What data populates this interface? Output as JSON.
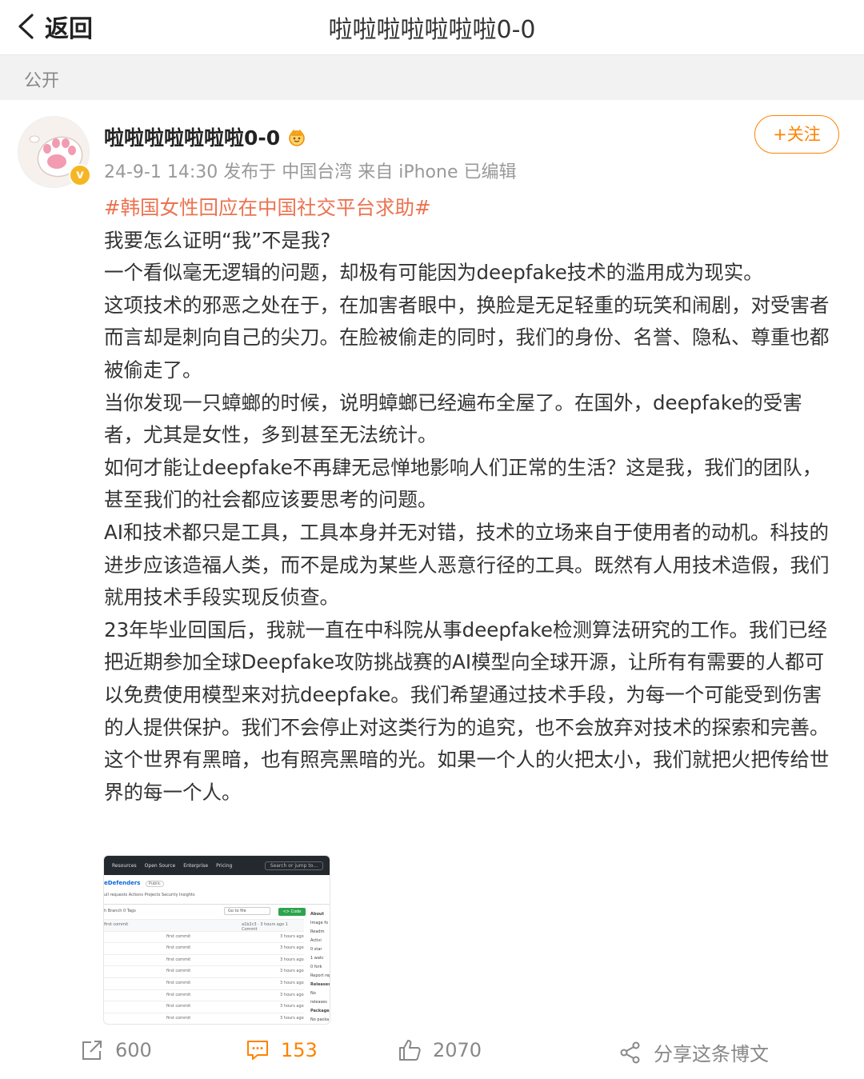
{
  "nav": {
    "back_label": "返回",
    "title": "啦啦啦啦啦啦啦0-0"
  },
  "visibility": "公开",
  "post": {
    "author": "啦啦啦啦啦啦啦0-0",
    "meta": "24-9-1 14:30 发布于 中国台湾 来自 iPhone 已编辑",
    "follow_label": "+关注",
    "hashtag": "#韩国女性回应在中国社交平台求助#",
    "paragraphs": [
      "我要怎么证明“我”不是我?",
      "一个看似毫无逻辑的问题，却极有可能因为deepfake技术的滥用成为现实。",
      "这项技术的邪恶之处在于，在加害者眼中，换脸是无足轻重的玩笑和闹剧，对受害者而言却是刺向自己的尖刀。在脸被偷走的同时，我们的身份、名誉、隐私、尊重也都被偷走了。",
      "当你发现一只蟑螂的时候，说明蟑螂已经遍布全屋了。在国外，deepfake的受害者，尤其是女性，多到甚至无法统计。",
      "如何才能让deepfake不再肆无忌惮地影响人们正常的生活？这是我，我们的团队，甚至我们的社会都应该要思考的问题。",
      "AI和技术都只是工具，工具本身并无对错，技术的立场来自于使用者的动机。科技的进步应该造福人类，而不是成为某些人恶意行径的工具。既然有人用技术造假，我们就用技术手段实现反侦查。",
      "23年毕业回国后，我就一直在中科院从事deepfake检测算法研究的工作。我们已经把近期参加全球Deepfake攻防挑战赛的AI模型向全球开源，让所有有需要的人都可以免费使用模型来对抗deepfake。我们希望通过技术手段，为每一个可能受到伤害的人提供保护。我们不会停止对这类行为的追究，也不会放弃对技术的探索和完善。",
      "这个世界有黑暗，也有照亮黑暗的光。如果一个人的火把太小，我们就把火把传给世界的每一个人。"
    ]
  },
  "thumbnail": {
    "nav_items": [
      "Resources",
      "Open Source",
      "Enterprise",
      "Pricing"
    ],
    "search": "Search or jump to...",
    "repo": "eDefenders",
    "badge": "Public",
    "tabs": "ull requests   Actions   Projects   Security   Insights",
    "branch": "h Branch  0 Tags",
    "goto": "Go to file",
    "code_btn": "<> Code",
    "about": "About",
    "commit_header": "first commit",
    "commit_meta": "a1b2c3 · 3 hours ago   1 Commit",
    "rows": [
      {
        "commit": "first commit",
        "time": "3 hours ago"
      },
      {
        "commit": "first commit",
        "time": "3 hours ago"
      },
      {
        "commit": "first commit",
        "time": "3 hours ago"
      },
      {
        "commit": "first commit",
        "time": "3 hours ago"
      },
      {
        "commit": "first commit",
        "time": "3 hours ago"
      },
      {
        "commit": "first commit",
        "time": "3 hours ago"
      },
      {
        "commit": "first commit",
        "time": "3 hours ago"
      },
      {
        "commit": "first commit",
        "time": "3 hours ago"
      }
    ],
    "side": [
      "Image fo",
      "Readm",
      "Activi",
      "0 star",
      "1 watc",
      "0 fork",
      "Report rep",
      "Releases",
      "No releases",
      "Packages",
      "No packa"
    ]
  },
  "actions": {
    "share_count": "600",
    "comment_count": "153",
    "like_count": "2070",
    "share_label": "分享这条博文"
  },
  "colors": {
    "accent": "#ff8200",
    "hashtag": "#eb7350",
    "muted": "#999999"
  }
}
